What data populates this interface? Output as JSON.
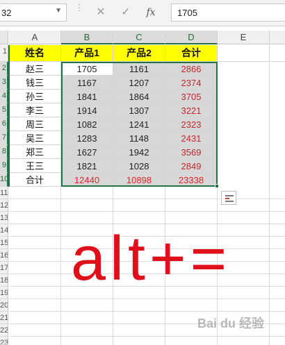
{
  "formula_bar": {
    "name_box": "32",
    "cancel_icon": "x-icon",
    "enter_icon": "check-icon",
    "fx_label": "fx",
    "formula_value": "1705"
  },
  "columns": [
    "A",
    "B",
    "C",
    "D",
    "E"
  ],
  "rows": [
    "1",
    "2",
    "3",
    "4",
    "5",
    "6",
    "7",
    "8",
    "9",
    "10",
    "11",
    "12",
    "13",
    "14",
    "15",
    "16",
    "17",
    "18",
    "19",
    "20",
    "21",
    "22",
    "23"
  ],
  "table": {
    "headers": [
      "姓名",
      "产品1",
      "产品2",
      "合计"
    ],
    "rows": [
      [
        "赵三",
        "1705",
        "1161",
        "2866"
      ],
      [
        "钱三",
        "1167",
        "1207",
        "2374"
      ],
      [
        "孙三",
        "1841",
        "1864",
        "3705"
      ],
      [
        "李三",
        "1914",
        "1307",
        "3221"
      ],
      [
        "周三",
        "1082",
        "1241",
        "2323"
      ],
      [
        "吴三",
        "1283",
        "1148",
        "2431"
      ],
      [
        "郑三",
        "1627",
        "1942",
        "3569"
      ],
      [
        "王三",
        "1821",
        "1028",
        "2849"
      ]
    ],
    "total": [
      "合计",
      "12440",
      "10898",
      "23338"
    ]
  },
  "overlay_text": "alt+=",
  "watermark": "Bai du 经验",
  "colors": {
    "header_fill": "#ffff00",
    "selection_fill": "#d7d7d7",
    "selection_border": "#217346",
    "sum_text": "#c0282e",
    "overlay_text": "#e0101a"
  }
}
